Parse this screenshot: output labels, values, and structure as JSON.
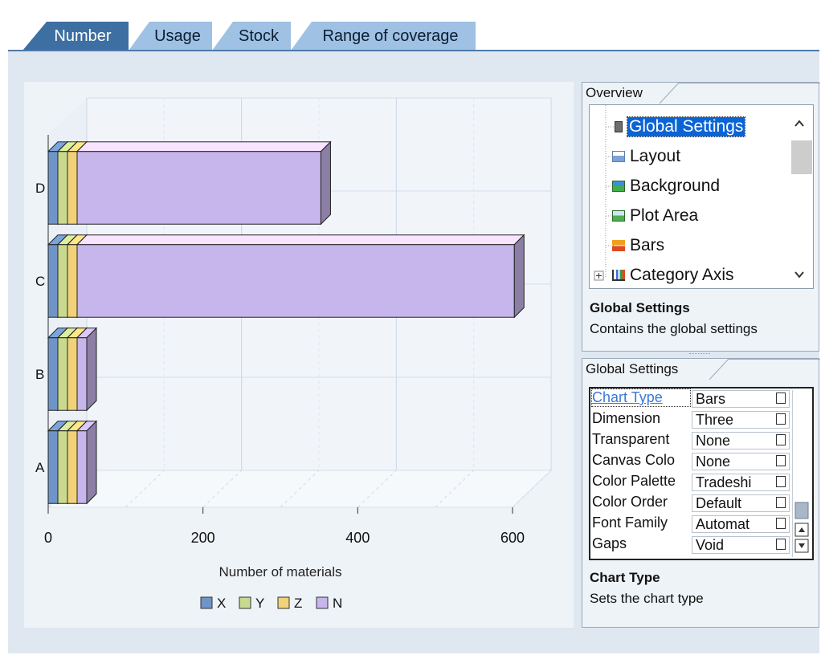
{
  "tabs": [
    {
      "label": "Number",
      "active": true
    },
    {
      "label": "Usage",
      "active": false
    },
    {
      "label": "Stock",
      "active": false
    },
    {
      "label": "Range of coverage",
      "active": false
    }
  ],
  "chart_data": {
    "type": "bar",
    "orientation": "horizontal",
    "three_d": true,
    "categories": [
      "A",
      "B",
      "C",
      "D"
    ],
    "series": [
      {
        "name": "X",
        "values": [
          0,
          0,
          0,
          0
        ],
        "color": "#6f95c8"
      },
      {
        "name": "Y",
        "values": [
          0,
          0,
          0,
          0
        ],
        "color": "#c9d98f"
      },
      {
        "name": "Z",
        "values": [
          0,
          0,
          0,
          0
        ],
        "color": "#f1d27a"
      },
      {
        "name": "N",
        "values": [
          0,
          0,
          565,
          315
        ],
        "color": "#c6b6ec"
      }
    ],
    "xlabel": "Number of materials",
    "xlim": [
      0,
      600
    ],
    "xticks": [
      "0",
      "200",
      "400",
      "600"
    ],
    "grid": true,
    "legend": "bottom"
  },
  "overview": {
    "tab": "Overview",
    "items": [
      {
        "label": "Global Settings",
        "icon": "global-settings-icon",
        "selected": true
      },
      {
        "label": "Layout",
        "icon": "layout-icon",
        "selected": false
      },
      {
        "label": "Background",
        "icon": "background-icon",
        "selected": false
      },
      {
        "label": "Plot Area",
        "icon": "plot-area-icon",
        "selected": false
      },
      {
        "label": "Bars",
        "icon": "bars-icon",
        "selected": false
      },
      {
        "label": "Category Axis",
        "icon": "category-axis-icon",
        "selected": false
      }
    ],
    "desc_title": "Global Settings",
    "desc_text": "Contains the global settings"
  },
  "settings": {
    "tab": "Global Settings",
    "rows": [
      {
        "name": "Chart Type",
        "value": "Bars"
      },
      {
        "name": "Dimension",
        "value": "Three"
      },
      {
        "name": "Transparent",
        "value": "None"
      },
      {
        "name": "Canvas Colo",
        "value": "None"
      },
      {
        "name": "Color Palette",
        "value": "Tradeshi"
      },
      {
        "name": "Color Order",
        "value": "Default"
      },
      {
        "name": "Font Family",
        "value": "Automat"
      },
      {
        "name": "Gaps",
        "value": "Void"
      }
    ],
    "desc_title": "Chart Type",
    "desc_text": "Sets the chart type"
  }
}
